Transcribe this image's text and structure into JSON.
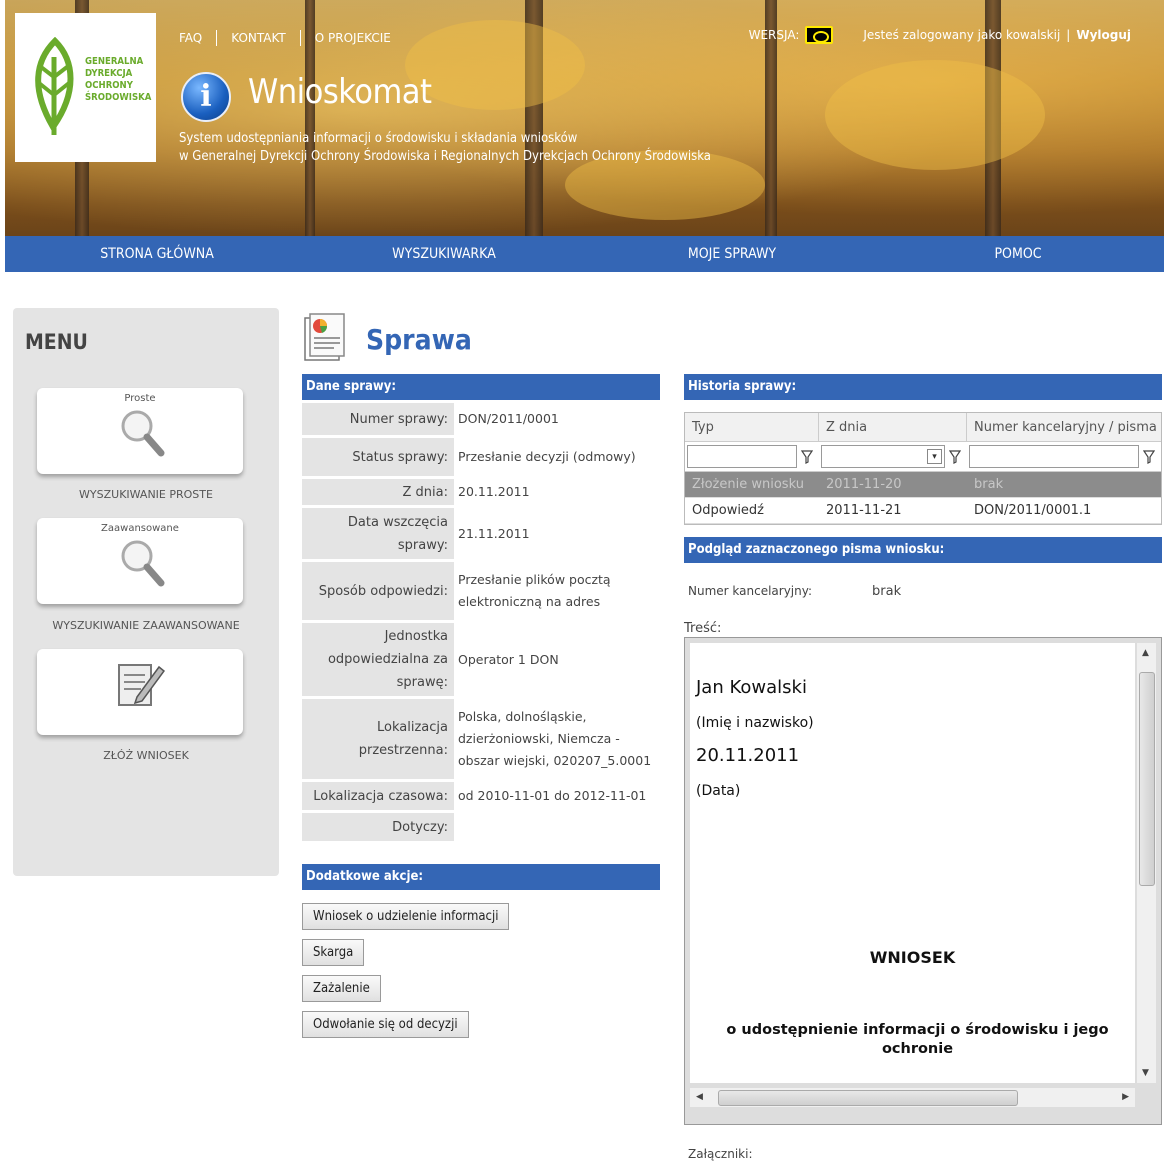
{
  "header": {
    "logo_lines": [
      "GENERALNA",
      "DYREKCJA",
      "OCHRONY",
      "ŚRODOWISKA"
    ],
    "top_links": [
      "FAQ",
      "KONTAKT",
      "O PROJEKCIE"
    ],
    "app_title": "Wnioskomat",
    "subtitle_line1": "System udostępniania informacji o środowisku i składania wniosków",
    "subtitle_line2": "w Generalnej Dyrekcji Ochrony Środowiska i Regionalnych Dyrekcjach Ochrony Środowiska",
    "version_label": "WERSJA:",
    "logged_in_text": "Jesteś zalogowany jako kowalskij",
    "separator": "|",
    "logout": "Wyloguj",
    "nav": [
      "STRONA GŁÓWNA",
      "WYSZUKIWARKA",
      "MOJE SPRAWY",
      "POMOC"
    ]
  },
  "sidebar": {
    "title": "MENU",
    "tiles": [
      {
        "label": "Proste",
        "caption": "WYSZUKIWANIE PROSTE",
        "icon": "magnifier-icon"
      },
      {
        "label": "Zaawansowane",
        "caption": "WYSZUKIWANIE ZAAWANSOWANE",
        "icon": "magnifier-icon"
      },
      {
        "label": "",
        "caption": "ZŁÓŻ WNIOSEK",
        "icon": "form-pencil-icon"
      }
    ]
  },
  "main": {
    "title": "Sprawa",
    "case_section": "Dane sprawy:",
    "case_rows": [
      {
        "k": "Numer sprawy:",
        "v": "DON/2011/0001"
      },
      {
        "k": "Status sprawy:",
        "v": "Przesłanie decyzji (odmowy)"
      },
      {
        "k": "Z dnia:",
        "v": "20.11.2011"
      },
      {
        "k": "Data wszczęcia sprawy:",
        "v": "21.11.2011"
      },
      {
        "k": "Sposób odpowiedzi:",
        "v": "Przesłanie plików pocztą elektroniczną na adres"
      },
      {
        "k": "Jednostka odpowiedzialna za sprawę:",
        "v": "Operator 1 DON"
      },
      {
        "k": "Lokalizacja przestrzenna:",
        "v": "Polska, dolnośląskie, dzierżoniowski, Niemcza - obszar wiejski, 020207_5.0001"
      },
      {
        "k": "Lokalizacja czasowa:",
        "v": "od 2010-11-01 do 2012-11-01"
      },
      {
        "k": "Dotyczy:",
        "v": ""
      }
    ],
    "actions_section": "Dodatkowe akcje:",
    "actions": [
      "Wniosek o udzielenie informacji",
      "Skarga",
      "Zażalenie",
      "Odwołanie się od decyzji"
    ]
  },
  "history": {
    "section": "Historia sprawy:",
    "columns": [
      "Typ",
      "Z dnia",
      "Numer kancelaryjny / pisma"
    ],
    "rows": [
      [
        "Złożenie wniosku",
        "2011-11-20",
        "brak"
      ],
      [
        "Odpowiedź",
        "2011-11-21",
        "DON/2011/0001.1"
      ]
    ]
  },
  "preview": {
    "section": "Podgląd zaznaczonego pisma wniosku:",
    "number_label": "Numer kancelaryjny:",
    "number_value": "brak",
    "content_label": "Treść:",
    "doc_name": "Jan Kowalski",
    "doc_name_caption": "(Imię i nazwisko)",
    "doc_date": "20.11.2011",
    "doc_date_caption": "(Data)",
    "doc_heading": "WNIOSEK",
    "doc_subheading": "o udostępnienie informacji o środowisku i jego ochronie",
    "attachments_label": "Załączniki:"
  },
  "colors": {
    "accent": "#3466b5",
    "logo_green": "#6aab2c"
  }
}
